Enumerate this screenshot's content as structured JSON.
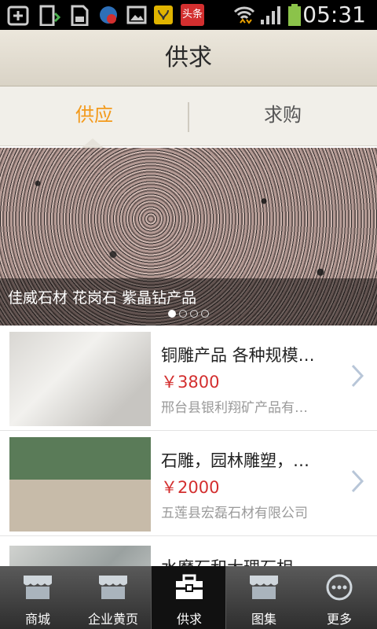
{
  "status_bar": {
    "time": "05:31",
    "icons": [
      "add-icon",
      "download-icon",
      "sd-card-icon",
      "shield-icon",
      "image-icon",
      "app-icon",
      "news-icon",
      "wifi-icon",
      "signal-icon",
      "battery-icon"
    ],
    "toutiao_label": "头条"
  },
  "header": {
    "title": "供求"
  },
  "tabs": [
    {
      "label": "供应",
      "active": true
    },
    {
      "label": "求购",
      "active": false
    }
  ],
  "banner": {
    "caption": "佳威石材 花岗石 紫晶钻产品",
    "slide_count": 4,
    "active_slide": 1
  },
  "products": [
    {
      "title": "铜雕产品 各种规模…",
      "price": "￥3800",
      "company": "邢台县银利翔矿产品有…"
    },
    {
      "title": "石雕，园林雕塑，…",
      "price": "￥2000",
      "company": "五莲县宏磊石材有限公司"
    },
    {
      "title": "水磨石和大理石相…",
      "price": "",
      "company": ""
    }
  ],
  "bottom_nav": [
    {
      "label": "商城",
      "icon": "store-icon"
    },
    {
      "label": "企业黄页",
      "icon": "store-icon"
    },
    {
      "label": "供求",
      "icon": "briefcase-icon",
      "active": true
    },
    {
      "label": "图集",
      "icon": "store-icon"
    },
    {
      "label": "更多",
      "icon": "more-icon"
    }
  ],
  "colors": {
    "accent": "#f39a1c",
    "price": "#d32f2f"
  }
}
